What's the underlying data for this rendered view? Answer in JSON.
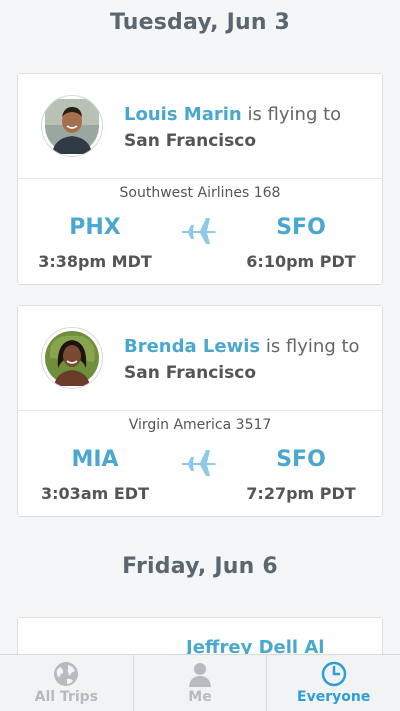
{
  "sections": [
    {
      "date": "Tuesday, Jun 3",
      "trips": [
        {
          "name": "Louis Marin",
          "verb": " is flying to",
          "destination": "San Francisco",
          "airline": "Southwest Airlines 168",
          "dep_code": "PHX",
          "dep_time": "3:38pm MDT",
          "arr_code": "SFO",
          "arr_time": "6:10pm PDT"
        },
        {
          "name": "Brenda Lewis",
          "verb": " is flying to",
          "destination": "San Francisco",
          "airline": "Virgin America 3517",
          "dep_code": "MIA",
          "dep_time": "3:03am EDT",
          "arr_code": "SFO",
          "arr_time": "7:27pm PDT"
        }
      ]
    },
    {
      "date": "Friday, Jun 6",
      "trips": [
        {
          "name_partial": "Jeffrey Dell Al"
        }
      ]
    }
  ],
  "tabbar": {
    "tabs": [
      {
        "label": "All Trips",
        "icon": "globe-icon",
        "active": false
      },
      {
        "label": "Me",
        "icon": "person-icon",
        "active": false
      },
      {
        "label": "Everyone",
        "icon": "clock-icon",
        "active": true
      }
    ]
  },
  "colors": {
    "accent": "#4aa8d0",
    "active_tab": "#2c9fd6",
    "inactive_tab": "#b6bbc0",
    "background": "#f5f6f7"
  }
}
